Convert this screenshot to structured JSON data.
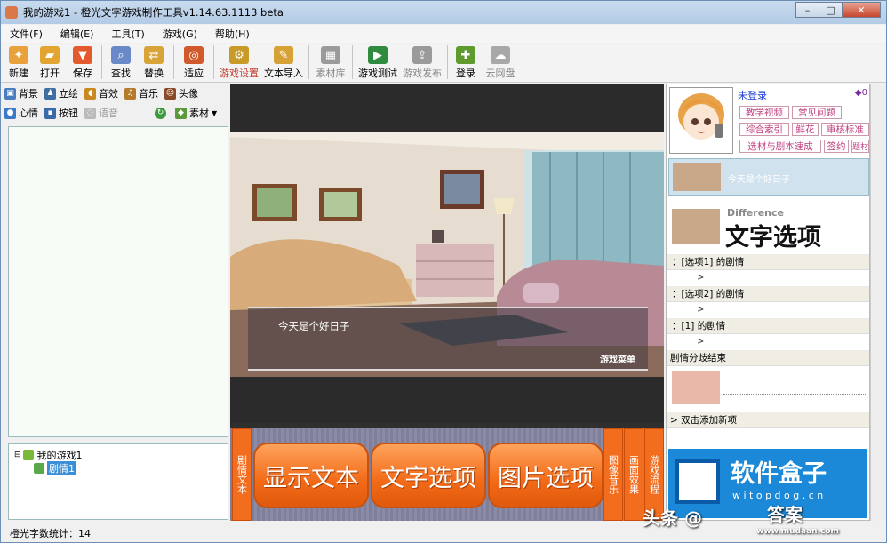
{
  "window": {
    "title": "我的游戏1 - 橙光文字游戏制作工具v1.14.63.1113 beta",
    "minimize": "–",
    "maximize": "□",
    "close": "✕"
  },
  "menu": [
    "文件(F)",
    "编辑(E)",
    "工具(T)",
    "游戏(G)",
    "帮助(H)"
  ],
  "toolbar": [
    {
      "label": "新建",
      "icon": "new-file-icon",
      "color": "#e9a23b"
    },
    {
      "label": "打开",
      "icon": "open-folder-icon",
      "color": "#e2a531"
    },
    {
      "label": "保存",
      "icon": "save-icon",
      "color": "#e35b2c"
    },
    {
      "label": "查找",
      "icon": "find-icon",
      "color": "#6a89c9"
    },
    {
      "label": "替换",
      "icon": "replace-icon",
      "color": "#d8a43a"
    },
    {
      "label": "适应",
      "icon": "fit-icon",
      "color": "#d05a2c"
    },
    {
      "label": "游戏设置",
      "icon": "gear-icon",
      "color": "#c89a28"
    },
    {
      "label": "文本导入",
      "icon": "text-import-icon",
      "color": "#d6a236"
    },
    {
      "label": "素材库",
      "icon": "material-library-icon",
      "color": "#9a9a9a"
    },
    {
      "label": "游戏测试",
      "icon": "play-test-icon",
      "color": "#2f8c3f"
    },
    {
      "label": "游戏发布",
      "icon": "publish-icon",
      "color": "#9a9a9a"
    },
    {
      "label": "登录",
      "icon": "login-icon",
      "color": "#5e9a2c"
    },
    {
      "label": "云网盘",
      "icon": "cloud-drive-icon",
      "color": "#a8a8a8"
    }
  ],
  "resources": {
    "row1": [
      "背景",
      "立绘",
      "音效",
      "音乐",
      "头像"
    ],
    "row2": [
      "心情",
      "按钮",
      "语音",
      "素材"
    ]
  },
  "tree": {
    "root": "我的游戏1",
    "child": "剧情1"
  },
  "status": {
    "char_count": "橙光字数统计：14"
  },
  "stage": {
    "dialogue": "今天是个好日子",
    "game_menu": "游戏菜单"
  },
  "bottom": {
    "left_tab": "剧情文本",
    "buttons": [
      "显示文本",
      "文字选项",
      "图片选项"
    ],
    "right_tabs": [
      "图像音乐",
      "画面效果",
      "游戏流程"
    ]
  },
  "right": {
    "login": "未登录",
    "gems": "0",
    "links": [
      "教学视频",
      "常见问题",
      "综合索引",
      "鲜花",
      "审核标准",
      "选材与剧本速成",
      "签约",
      "题材"
    ],
    "event_text": "今天是个好日子",
    "option_title_en": "Difference",
    "option_title_cn": "文字选项",
    "options": [
      "：[选项1] 的剧情",
      "：[选项2] 的剧情",
      "：[1] 的剧情"
    ],
    "option_children": [
      ">",
      ">",
      ">"
    ],
    "branch_end": "剧情分歧结束",
    "add_new": "> 双击添加新项",
    "ad_cn": "软件盒子",
    "ad_url": "w i t o p d o g . c n"
  },
  "watermark": {
    "left": "头条 @",
    "right": "答案",
    "site": "www.mudaan.com"
  }
}
